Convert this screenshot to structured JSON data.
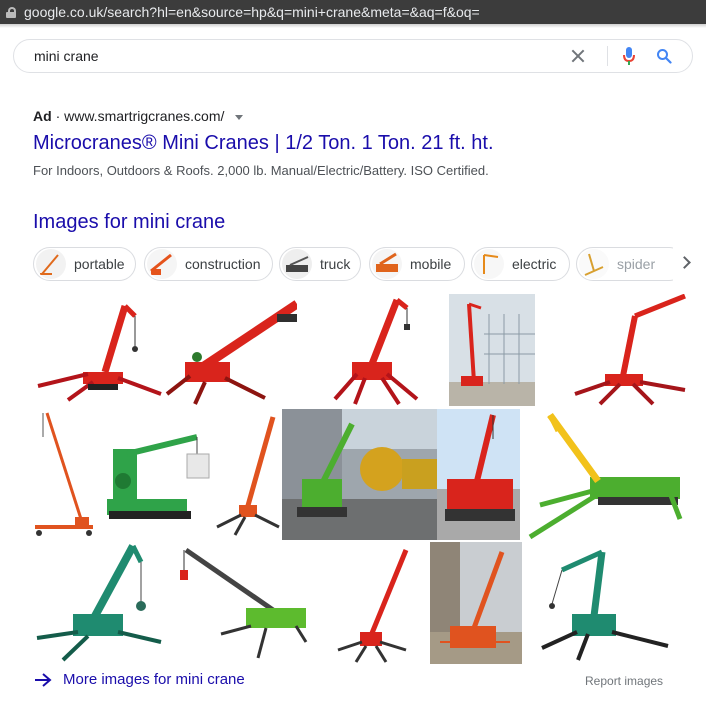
{
  "browser": {
    "url": "google.co.uk/search?hl=en&source=hp&q=mini+crane&meta=&aq=f&oq="
  },
  "search": {
    "query": "mini crane"
  },
  "ad": {
    "label": "Ad",
    "domain": "www.smartrigcranes.com/",
    "title": "Microcranes® Mini Cranes | 1/2 Ton. 1 Ton. 21 ft. ht.",
    "description": "For Indoors, Outdoors & Roofs. 2,000 lb. Manual/Electric/Battery. ISO Certified."
  },
  "images": {
    "heading": "Images for mini crane",
    "chips": [
      {
        "label": "portable",
        "color": "#e06a1c"
      },
      {
        "label": "construction",
        "color": "#e5531b"
      },
      {
        "label": "truck",
        "color": "#444444"
      },
      {
        "label": "mobile",
        "color": "#e0641c"
      },
      {
        "label": "electric",
        "color": "#e68a1a"
      },
      {
        "label": "spider",
        "color": "#d8a030"
      }
    ],
    "more_link": "More images for mini crane",
    "report": "Report images"
  },
  "colors": {
    "crane_red": "#d9241c",
    "crane_green": "#2fa349",
    "crane_teal": "#1f8b70",
    "crane_orange": "#e0531f",
    "link": "#1a0dab"
  }
}
